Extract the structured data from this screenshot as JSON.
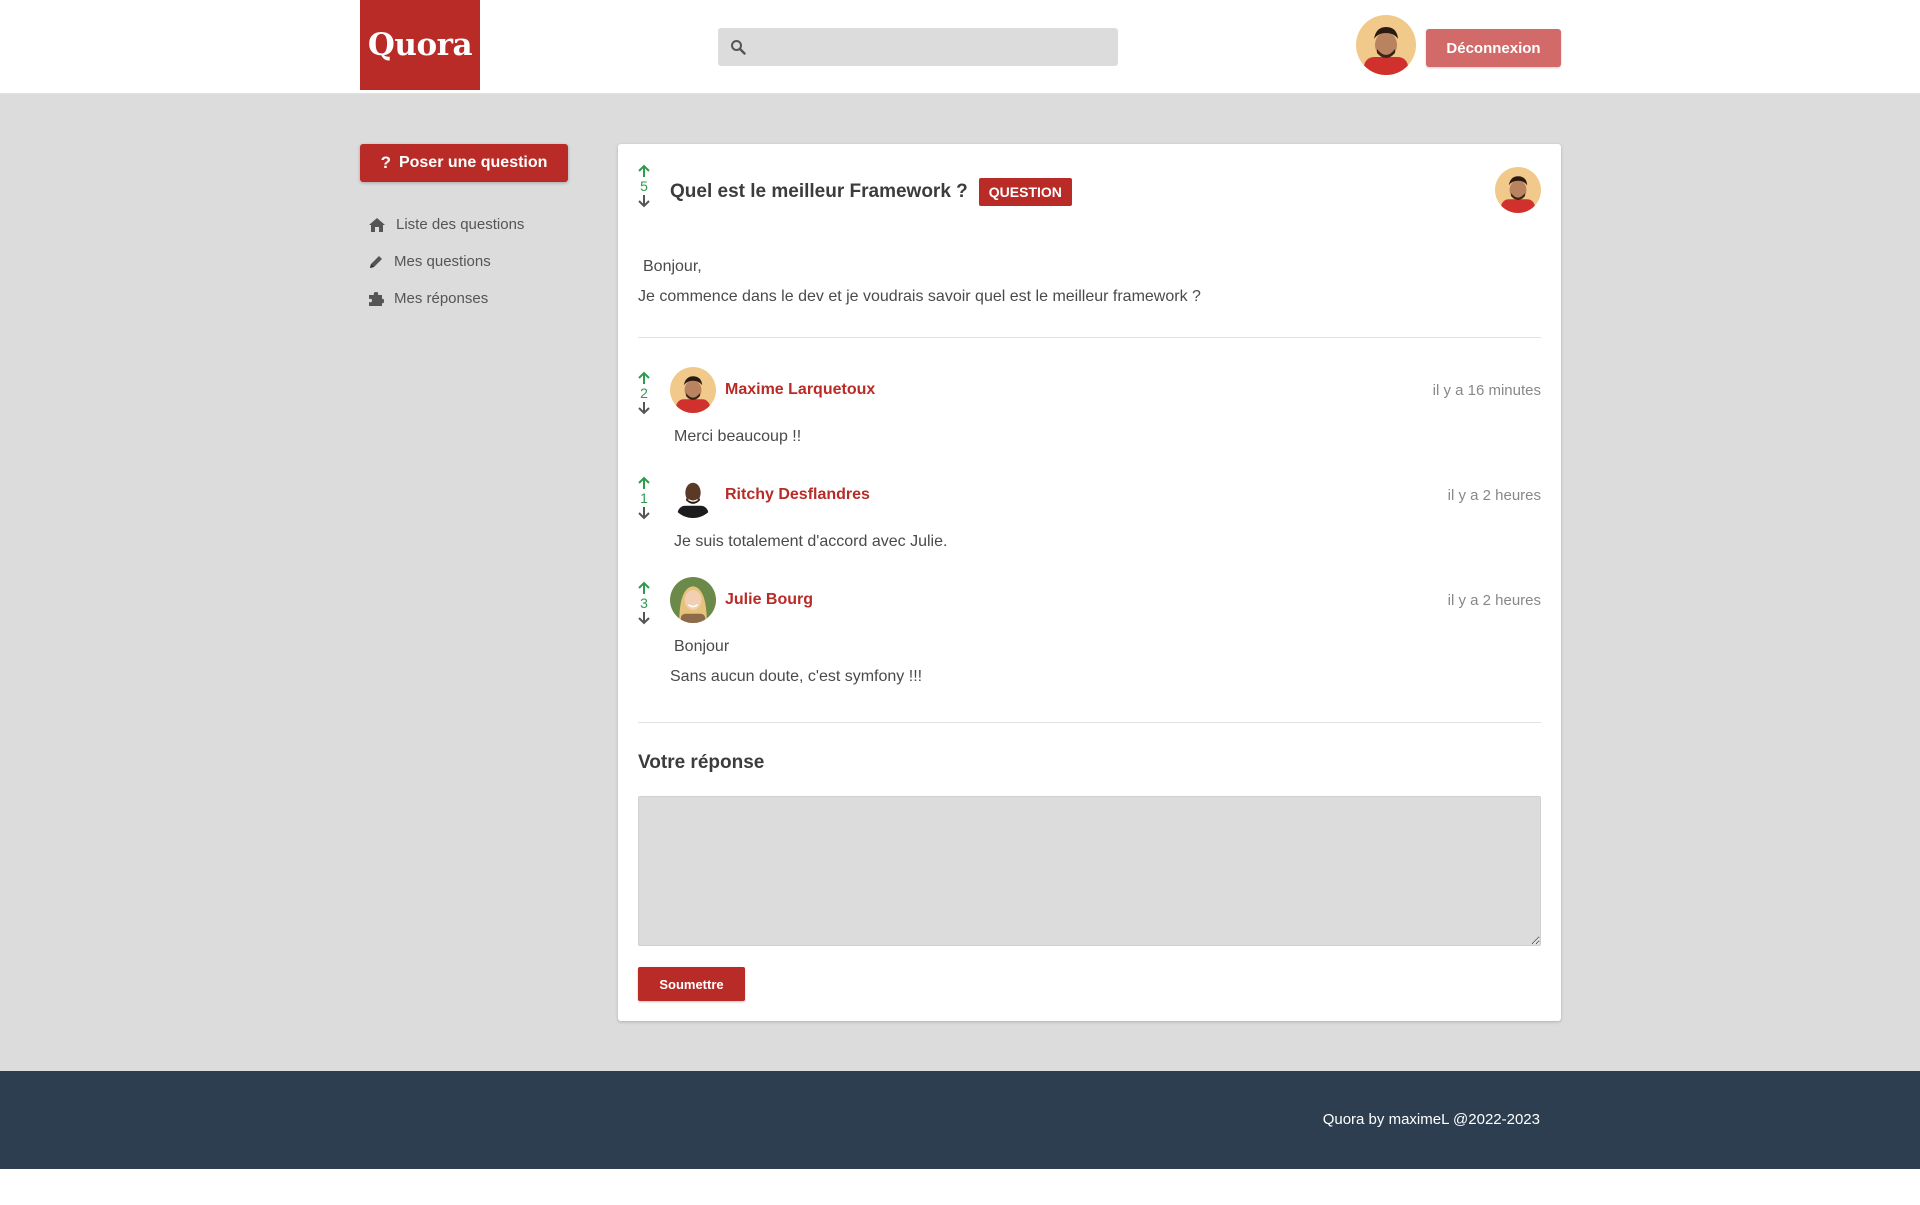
{
  "header": {
    "logo_text": "Quora",
    "search_placeholder": "",
    "logout_label": "Déconnexion"
  },
  "sidebar": {
    "ask_label": "Poser une question",
    "ask_icon": "?",
    "items": [
      {
        "label": "Liste des questions",
        "icon": "home-icon"
      },
      {
        "label": "Mes questions",
        "icon": "pencil-icon"
      },
      {
        "label": "Mes réponses",
        "icon": "puzzle-icon"
      }
    ]
  },
  "question": {
    "votes": "5",
    "title": "Quel est le meilleur Framework ?",
    "badge": "QUESTION",
    "body_line1": "Bonjour,",
    "body_line2": "Je commence dans le dev et je voudrais savoir quel est le meilleur framework ?"
  },
  "answers": [
    {
      "votes": "2",
      "author": "Maxime Larquetoux",
      "time": "il y a 16 minutes",
      "lines": [
        "Merci beaucoup !!"
      ]
    },
    {
      "votes": "1",
      "author": "Ritchy Desflandres",
      "time": "il y a 2 heures",
      "lines": [
        "Je suis totalement d'accord avec Julie."
      ]
    },
    {
      "votes": "3",
      "author": "Julie Bourg",
      "time": "il y a 2 heures",
      "lines": [
        "Bonjour",
        "Sans aucun doute, c'est symfony !!!"
      ]
    }
  ],
  "reply": {
    "title": "Votre réponse",
    "submit_label": "Soumettre"
  },
  "footer": {
    "text": "Quora by maximeL @2022-2023"
  },
  "colors": {
    "brand": "#b92b27",
    "logout": "#d26a6a",
    "vote": "#2e9b4f",
    "footer_bg": "#2c3e50",
    "page_bg": "#dcdcdc"
  }
}
